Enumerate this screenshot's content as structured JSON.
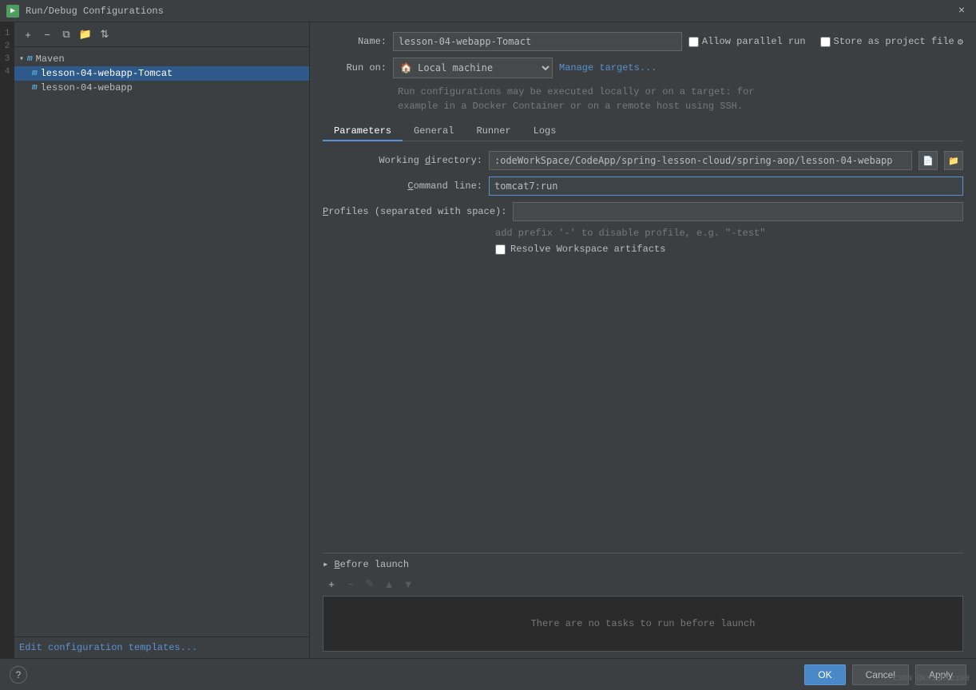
{
  "titleBar": {
    "title": "Run/Debug Configurations",
    "closeLabel": "×"
  },
  "leftPanel": {
    "toolbar": {
      "add": "+",
      "remove": "−",
      "copy": "⧉",
      "folder": "📁",
      "sort": "⇅"
    },
    "tree": {
      "groups": [
        {
          "label": "Maven",
          "icon": "m",
          "expanded": true,
          "items": [
            {
              "label": "lesson-04-webapp-Tomcat",
              "selected": true
            },
            {
              "label": "lesson-04-webapp",
              "selected": false
            }
          ]
        }
      ]
    },
    "editTemplatesLink": "Edit configuration templates..."
  },
  "rightPanel": {
    "nameLabel": "Name:",
    "nameValue": "lesson-04-webapp-Tomact",
    "allowParallelLabel": "Allow parallel run",
    "storeAsProjectLabel": "Store as project file",
    "runOnLabel": "Run on:",
    "runOnValue": "Local machine",
    "manageTargetsLabel": "Manage targets...",
    "infoText": "Run configurations may be executed locally or on a target: for\nexample in a Docker Container or on a remote host using SSH.",
    "tabs": [
      {
        "label": "Parameters",
        "active": true
      },
      {
        "label": "General",
        "active": false
      },
      {
        "label": "Runner",
        "active": false
      },
      {
        "label": "Logs",
        "active": false
      }
    ],
    "workingDirectoryLabel": "Working directory:",
    "workingDirectoryValue": ":odeWorkSpace/CodeApp/spring-lesson-cloud/spring-aop/lesson-04-webapp",
    "commandLineLabel": "Command line:",
    "commandLineValue": "tomcat7:run",
    "profilesLabel": "Profiles (separated with space):",
    "profilesValue": "",
    "profilesHint": "add prefix '-' to disable profile, e.g. \"-test\"",
    "resolveWorkspaceLabel": "Resolve Workspace artifacts"
  },
  "beforeLaunch": {
    "title": "Before launch",
    "titleUnderline": "B",
    "noTasksText": "There are no tasks to run before launch",
    "toolbar": {
      "add": "+",
      "remove": "−",
      "edit": "✎",
      "up": "▲",
      "down": "▼"
    }
  },
  "bottomBar": {
    "helpLabel": "?",
    "okLabel": "OK",
    "cancelLabel": "Cancel",
    "applyLabel": "Apply"
  },
  "sideNumbers": [
    "1",
    "2",
    "3",
    "4"
  ],
  "watermark": "CSDN @knightzz98"
}
